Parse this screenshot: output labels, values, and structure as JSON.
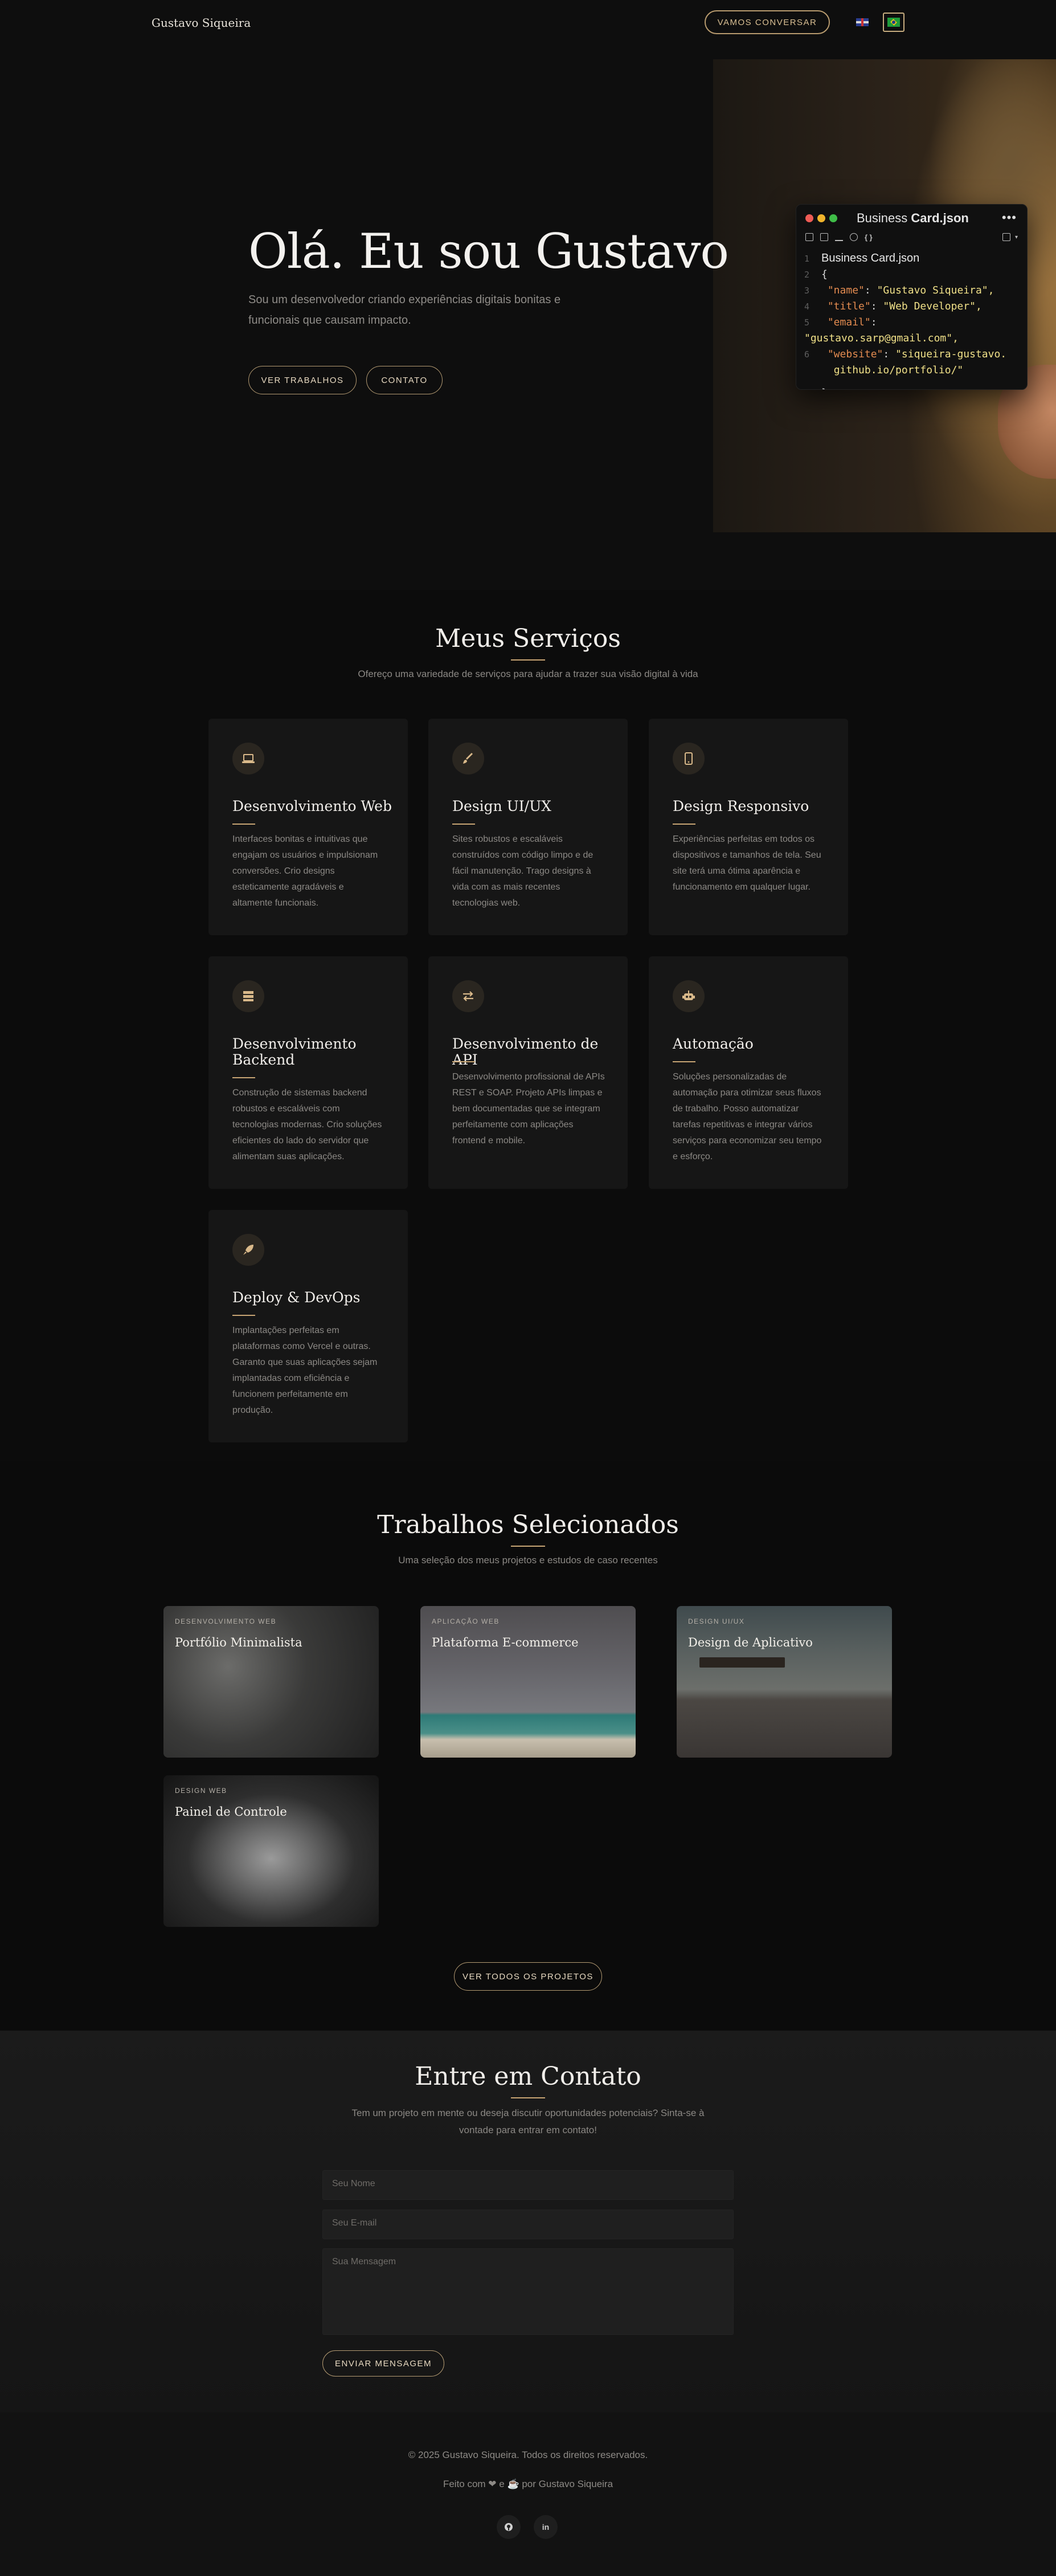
{
  "nav": {
    "brand": "Gustavo Siqueira",
    "cta": "VAMOS CONVERSAR",
    "languages": [
      "en",
      "pt-BR"
    ],
    "active_language": "pt-BR"
  },
  "hero": {
    "title": "Olá. Eu sou Gustavo",
    "subtitle": "Sou um desenvolvedor criando experiências digitais bonitas e funcionais que causam impacto.",
    "btn_work": "VER TRABALHOS",
    "btn_contact": "CONTATO",
    "card": {
      "title_light": "Business ",
      "title_bold": "Card.json",
      "first_line": "Business Card.json",
      "open_brace": "{",
      "close_brace": "}",
      "lines": [
        {
          "num": "3",
          "key": "\"name\"",
          "value": "\"Gustavo Siqueira\","
        },
        {
          "num": "4",
          "key": "\"title\"",
          "value": "\"Web Developer\","
        },
        {
          "num": "5",
          "key": "\"email\"",
          "value": "\"gustavo.sarp@gmail.com\","
        },
        {
          "num": "6",
          "key": "\"website\"",
          "value": "\"siqueira-gustavo."
        },
        {
          "num": "",
          "key": "",
          "value": "github.io/portfolio/\""
        }
      ]
    }
  },
  "services": {
    "title": "Meus Serviços",
    "subtitle": "Ofereço uma variedade de serviços para ajudar a trazer sua visão digital à vida",
    "items": [
      {
        "icon": "laptop-icon",
        "title": "Desenvolvimento Web",
        "text": "Interfaces bonitas e intuitivas que engajam os usuários e impulsionam conversões. Crio designs esteticamente agradáveis e altamente funcionais."
      },
      {
        "icon": "brush-icon",
        "title": "Design UI/UX",
        "text": "Sites robustos e escaláveis construídos com código limpo e de fácil manutenção. Trago designs à vida com as mais recentes tecnologias web."
      },
      {
        "icon": "mobile-icon",
        "title": "Design Responsivo",
        "text": "Experiências perfeitas em todos os dispositivos e tamanhos de tela. Seu site terá uma ótima aparência e funcionamento em qualquer lugar."
      },
      {
        "icon": "server-icon",
        "title": "Desenvolvimento Backend",
        "text": "Construção de sistemas backend robustos e escaláveis com tecnologias modernas. Crio soluções eficientes do lado do servidor que alimentam suas aplicações."
      },
      {
        "icon": "exchange-icon",
        "title": "Desenvolvimento de API",
        "text": "Desenvolvimento profissional de APIs REST e SOAP. Projeto APIs limpas e bem documentadas que se integram perfeitamente com aplicações frontend e mobile."
      },
      {
        "icon": "robot-icon",
        "title": "Automação",
        "text": "Soluções personalizadas de automação para otimizar seus fluxos de trabalho. Posso automatizar tarefas repetitivas e integrar vários serviços para economizar seu tempo e esforço."
      },
      {
        "icon": "rocket-icon",
        "title": "Deploy & DevOps",
        "text": "Implantações perfeitas em plataformas como Vercel e outras. Garanto que suas aplicações sejam implantadas com eficiência e funcionem perfeitamente em produção."
      }
    ]
  },
  "works": {
    "title": "Trabalhos Selecionados",
    "subtitle": "Uma seleção dos meus projetos e estudos de caso recentes",
    "projects": [
      {
        "category": "DESENVOLVIMENTO WEB",
        "name": "Portfólio Minimalista"
      },
      {
        "category": "APLICAÇÃO WEB",
        "name": "Plataforma E-commerce"
      },
      {
        "category": "DESIGN UI/UX",
        "name": "Design de Aplicativo"
      },
      {
        "category": "DESIGN WEB",
        "name": "Painel de Controle"
      }
    ],
    "view_all": "VER TODOS OS PROJETOS"
  },
  "contact": {
    "title": "Entre em Contato",
    "subtitle": "Tem um projeto em mente ou deseja discutir oportunidades potenciais? Sinta-se à vontade para entrar em contato!",
    "name_placeholder": "Seu Nome",
    "email_placeholder": "Seu E-mail",
    "message_placeholder": "Sua Mensagem",
    "submit": "ENVIAR MENSAGEM"
  },
  "footer": {
    "copyright": "© 2025 Gustavo Siqueira. Todos os direitos reservados.",
    "made_with": "Feito com ❤ e ☕ por Gustavo Siqueira",
    "social": [
      "github-icon",
      "linkedin-icon"
    ]
  }
}
